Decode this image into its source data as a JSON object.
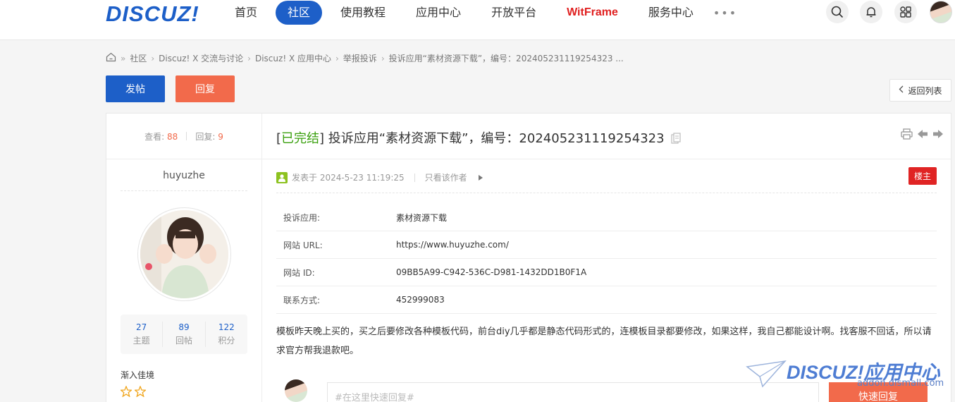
{
  "header": {
    "logo": "DISCUZ!",
    "nav": [
      {
        "label": "首页",
        "active": false
      },
      {
        "label": "社区",
        "active": true
      },
      {
        "label": "使用教程",
        "active": false
      },
      {
        "label": "应用中心",
        "active": false
      },
      {
        "label": "开放平台",
        "active": false
      },
      {
        "label": "WitFrame",
        "active": false
      },
      {
        "label": "服务中心",
        "active": false
      }
    ],
    "more": "•••",
    "icons": [
      "search-icon",
      "bell-icon",
      "apps-icon",
      "user-avatar"
    ]
  },
  "breadcrumb": {
    "home_icon": "home-icon",
    "items": [
      "社区",
      "Discuz! X 交流与讨论",
      "Discuz! X 应用中心",
      "举报投诉",
      "投诉应用“素材资源下载”，编号：202405231119254323 ..."
    ]
  },
  "actions": {
    "post": "发帖",
    "reply": "回复",
    "back": "返回列表"
  },
  "thread": {
    "views_label": "查看:",
    "views": "88",
    "replies_label": "回复:",
    "replies": "9",
    "title_tag_open": "[",
    "title_tag": "已完结",
    "title_tag_close": "]",
    "title": " 投诉应用“素材资源下载”，编号：202405231119254323"
  },
  "author": {
    "name": "huyuzhe",
    "stats": [
      {
        "value": "27",
        "label": "主题"
      },
      {
        "value": "89",
        "label": "回帖"
      },
      {
        "value": "122",
        "label": "积分"
      }
    ],
    "level": "渐入佳境",
    "stars": 2
  },
  "post": {
    "posted_at": "发表于 2024-5-23 11:19:25",
    "only_author": "只看该作者",
    "floor": "楼主",
    "fields": [
      {
        "key": "投诉应用:",
        "value": "素材资源下载"
      },
      {
        "key": "网站 URL:",
        "value": "https://www.huyuzhe.com/"
      },
      {
        "key": "网站 ID:",
        "value": "09BB5A99-C942-536C-D981-1432DD1B0F1A"
      },
      {
        "key": "联系方式:",
        "value": "452999083"
      }
    ],
    "body": "模板昨天晚上买的，买之后要修改各种模板代码，前台diy几乎都是静态代码形式的，连模板目录都要修改，如果这样，我自己都能设计啊。找客服不回话，所以请求官方帮我退款吧。"
  },
  "quick_reply": {
    "placeholder": "#在这里快速回复#",
    "button": "快速回复"
  },
  "watermark": {
    "logo": "DISCUZ!应用中心",
    "url": "addon.dismall.com"
  },
  "colors": {
    "primary": "#1d5fc8",
    "accent": "#f26a4b",
    "done": "#3aa00e",
    "floor": "#e02424"
  }
}
